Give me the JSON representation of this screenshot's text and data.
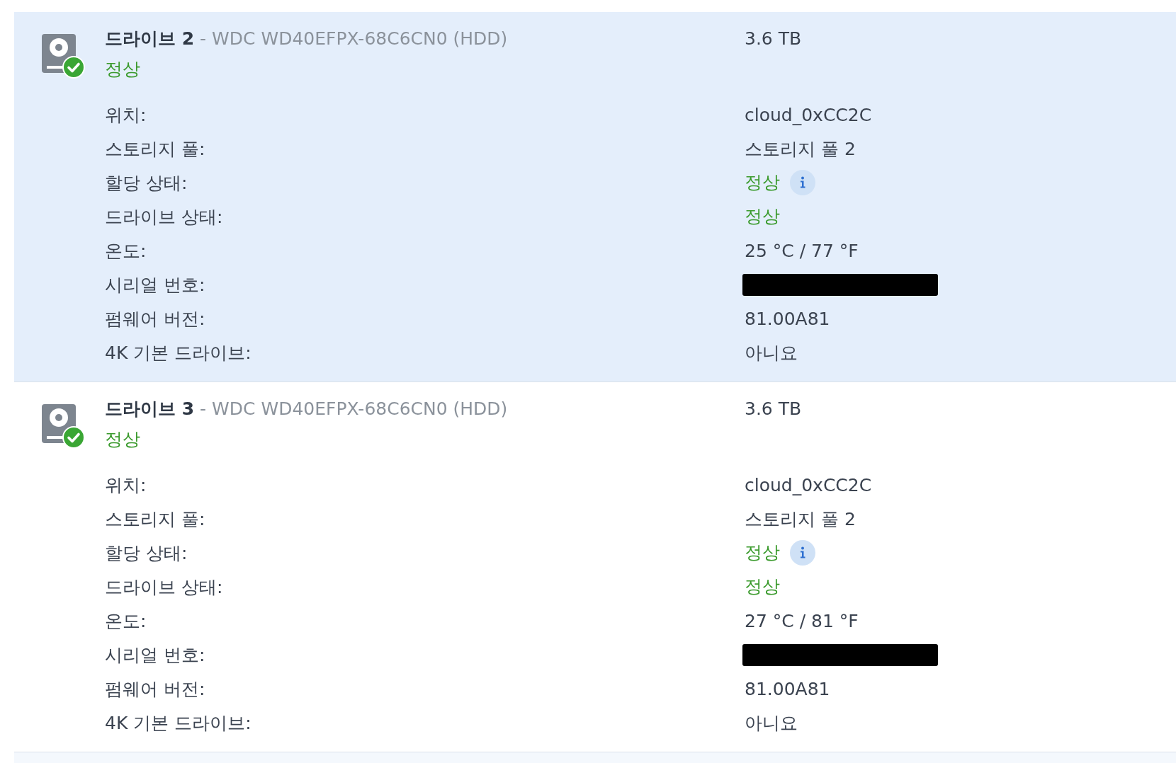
{
  "drives": [
    {
      "name": "드라이브 2",
      "model": "- WDC WD40EFPX-68C6CN0 (HDD)",
      "status": "정상",
      "capacity": "3.6 TB",
      "selected": true,
      "details": [
        {
          "kind": "text",
          "label": "위치:",
          "value": "cloud_0xCC2C"
        },
        {
          "kind": "text",
          "label": "스토리지 풀:",
          "value": "스토리지 풀 2"
        },
        {
          "kind": "status_info",
          "label": "할당 상태:",
          "value": "정상"
        },
        {
          "kind": "status",
          "label": "드라이브 상태:",
          "value": "정상"
        },
        {
          "kind": "text",
          "label": "온도:",
          "value": "25 °C / 77 °F"
        },
        {
          "kind": "redacted",
          "label": "시리얼 번호:"
        },
        {
          "kind": "text",
          "label": "펌웨어 버전:",
          "value": "81.00A81"
        },
        {
          "kind": "text",
          "label": "4K 기본 드라이브:",
          "value": "아니요"
        }
      ]
    },
    {
      "name": "드라이브 3",
      "model": "- WDC WD40EFPX-68C6CN0 (HDD)",
      "status": "정상",
      "capacity": "3.6 TB",
      "selected": false,
      "details": [
        {
          "kind": "text",
          "label": "위치:",
          "value": "cloud_0xCC2C"
        },
        {
          "kind": "text",
          "label": "스토리지 풀:",
          "value": "스토리지 풀 2"
        },
        {
          "kind": "status_info",
          "label": "할당 상태:",
          "value": "정상"
        },
        {
          "kind": "status",
          "label": "드라이브 상태:",
          "value": "정상"
        },
        {
          "kind": "text",
          "label": "온도:",
          "value": "27 °C / 81 °F"
        },
        {
          "kind": "redacted",
          "label": "시리얼 번호:"
        },
        {
          "kind": "text",
          "label": "펌웨어 버전:",
          "value": "81.00A81"
        },
        {
          "kind": "text",
          "label": "4K 기본 드라이브:",
          "value": "아니요"
        }
      ]
    }
  ]
}
